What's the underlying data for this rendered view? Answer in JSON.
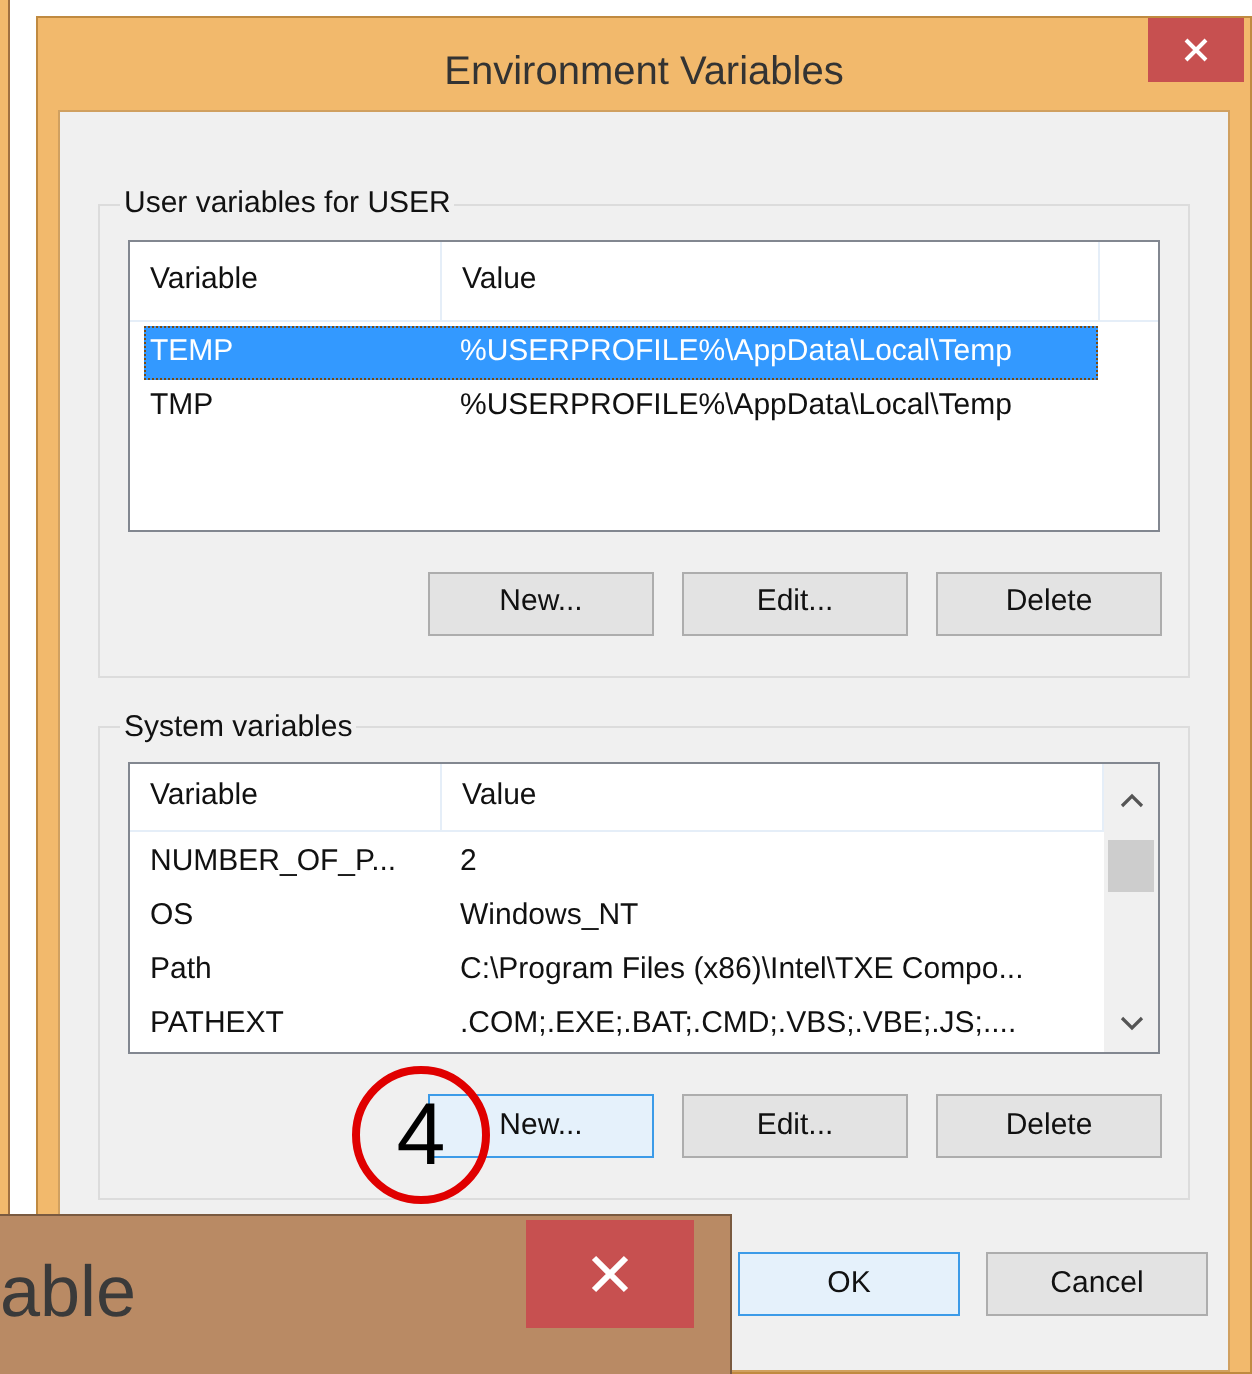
{
  "window": {
    "title": "Environment Variables"
  },
  "user_variables": {
    "label": "User variables for USER",
    "columns": [
      "Variable",
      "Value"
    ],
    "rows": [
      {
        "variable": "TEMP",
        "value": "%USERPROFILE%\\AppData\\Local\\Temp",
        "selected": true
      },
      {
        "variable": "TMP",
        "value": "%USERPROFILE%\\AppData\\Local\\Temp",
        "selected": false
      }
    ],
    "buttons": [
      {
        "label": "New...",
        "highlighted": false
      },
      {
        "label": "Edit...",
        "highlighted": false
      },
      {
        "label": "Delete",
        "highlighted": false
      }
    ]
  },
  "system_variables": {
    "label": "System variables",
    "columns": [
      "Variable",
      "Value"
    ],
    "rows": [
      {
        "variable": "NUMBER_OF_P...",
        "value": "2",
        "selected": false
      },
      {
        "variable": "OS",
        "value": "Windows_NT",
        "selected": false
      },
      {
        "variable": "Path",
        "value": "C:\\Program Files (x86)\\Intel\\TXE Compo...",
        "selected": false
      },
      {
        "variable": "PATHEXT",
        "value": ".COM;.EXE;.BAT;.CMD;.VBS;.VBE;.JS;....",
        "selected": false
      }
    ],
    "buttons": [
      {
        "label": "New...",
        "highlighted": true
      },
      {
        "label": "Edit...",
        "highlighted": false
      },
      {
        "label": "Delete",
        "highlighted": false
      }
    ]
  },
  "dialog_buttons": [
    {
      "label": "OK",
      "highlighted": true
    },
    {
      "label": "Cancel",
      "highlighted": false
    }
  ],
  "annotation": {
    "text": "4"
  },
  "overlapping_window": {
    "title": "able"
  }
}
